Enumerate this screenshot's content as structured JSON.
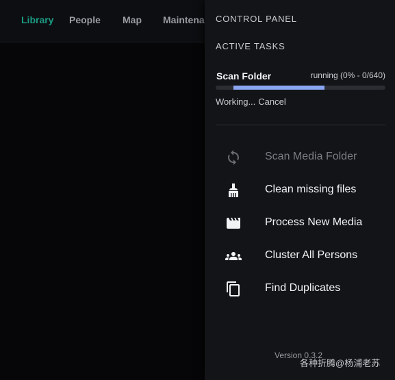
{
  "nav": {
    "items": [
      {
        "label": "Library"
      },
      {
        "label": "People"
      },
      {
        "label": "Map"
      },
      {
        "label": "Maintena"
      }
    ]
  },
  "panel": {
    "title": "CONTROL PANEL",
    "active_tasks_title": "ACTIVE TASKS",
    "task": {
      "name": "Scan Folder",
      "status": "running (0% - 0/640)",
      "progress": 0,
      "message": "Working...",
      "cancel_label": "Cancel"
    },
    "actions": [
      {
        "label": "Scan Media Folder",
        "icon": "sync-icon",
        "disabled": true
      },
      {
        "label": "Clean missing files",
        "icon": "broom-icon",
        "disabled": false
      },
      {
        "label": "Process New Media",
        "icon": "movie-icon",
        "disabled": false
      },
      {
        "label": "Cluster All Persons",
        "icon": "people-group-icon",
        "disabled": false
      },
      {
        "label": "Find Duplicates",
        "icon": "copy-icon",
        "disabled": false
      }
    ],
    "version": "Version 0.3.2"
  },
  "watermark": "各种折腾@杨浦老苏",
  "colors": {
    "accent": "#1b9c85",
    "progress": "#8aa6f2",
    "panel_bg": "#131417",
    "page_bg": "#060608"
  }
}
